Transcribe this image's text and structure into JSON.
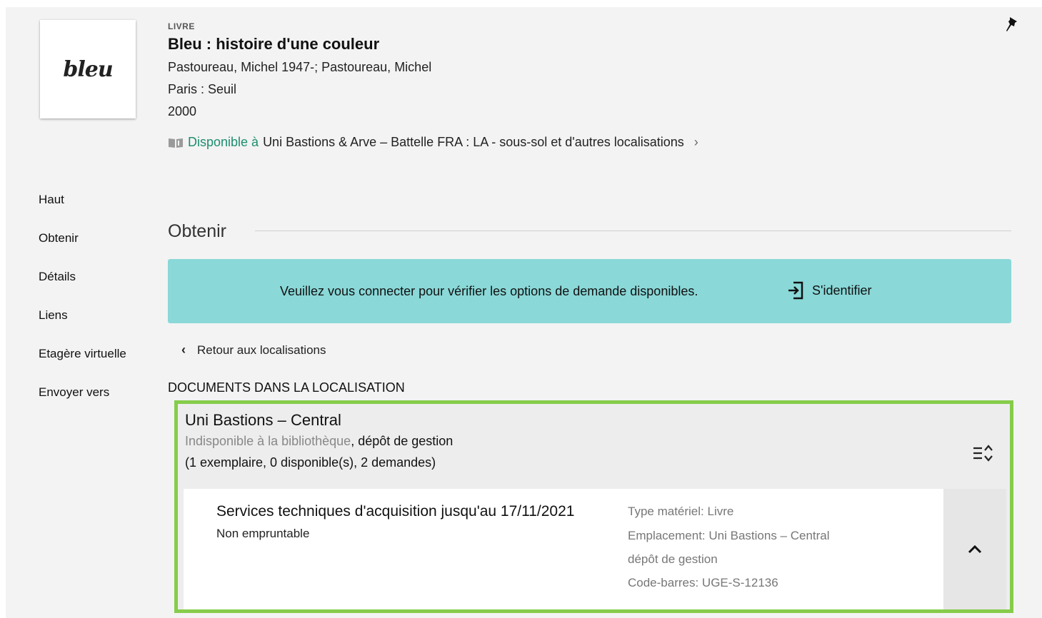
{
  "record": {
    "type_label": "LIVRE",
    "title": "Bleu : histoire d'une couleur",
    "authors": "Pastoureau, Michel 1947-; Pastoureau, Michel",
    "publisher": "Paris : Seuil",
    "year": "2000",
    "cover_text": "bleu",
    "availability": {
      "status": "Disponible à",
      "location": "Uni Bastions & Arve – Battelle  FRA : LA - sous-sol et d'autres localisations",
      "icon": "book-icon"
    }
  },
  "sidenav": {
    "items": [
      {
        "label": "Haut"
      },
      {
        "label": "Obtenir"
      },
      {
        "label": "Détails"
      },
      {
        "label": "Liens"
      },
      {
        "label": "Etagère virtuelle"
      },
      {
        "label": "Envoyer vers"
      }
    ]
  },
  "section": {
    "title": "Obtenir"
  },
  "login_banner": {
    "message": "Veuillez vous connecter pour vérifier les options de demande disponibles.",
    "signin_label": "S'identifier",
    "color": "#8ad8d8"
  },
  "back_link": {
    "label": "Retour aux localisations"
  },
  "documents": {
    "header": "DOCUMENTS DANS LA LOCALISATION",
    "location": {
      "name": "Uni Bastions – Central",
      "status": "Indisponible à la bibliothèque",
      "status_suffix": ", dépôt de gestion",
      "counts": "(1 exemplaire, 0 disponible(s), 2 demandes)"
    },
    "item": {
      "title": "Services techniques d'acquisition jusqu'au 17/11/2021",
      "subtitle": "Non empruntable",
      "material_type": "Type matériel: Livre",
      "placement": "Emplacement: Uni Bastions – Central",
      "placement_detail": "dépôt de gestion",
      "barcode": "Code-barres: UGE-S-12136"
    }
  },
  "colors": {
    "accent_green": "#1d8d6e",
    "highlight_border": "#86cc4b"
  }
}
